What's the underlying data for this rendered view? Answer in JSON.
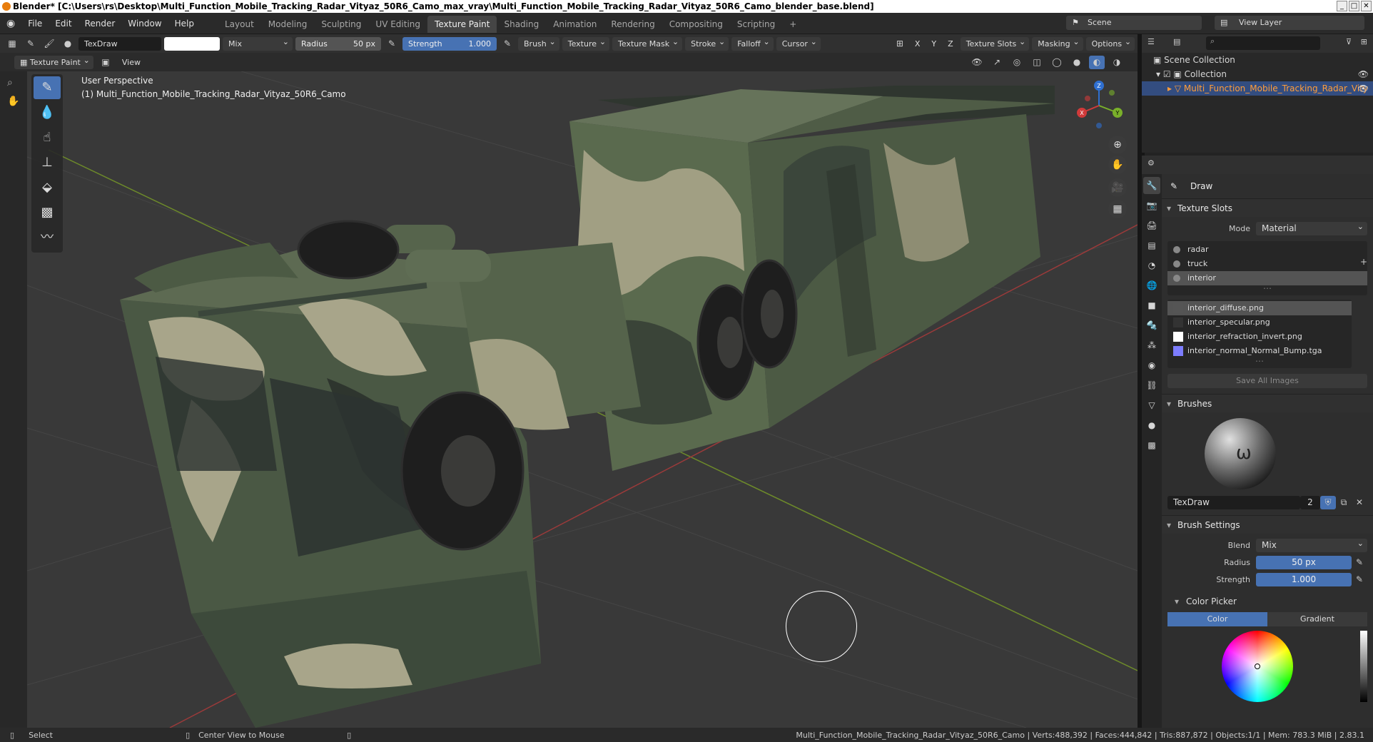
{
  "window": {
    "title": "Blender* [C:\\Users\\rs\\Desktop\\Multi_Function_Mobile_Tracking_Radar_Vityaz_50R6_Camo_max_vray\\Multi_Function_Mobile_Tracking_Radar_Vityaz_50R6_Camo_blender_base.blend]"
  },
  "menu": [
    "File",
    "Edit",
    "Render",
    "Window",
    "Help"
  ],
  "workspaces": [
    {
      "label": "Layout"
    },
    {
      "label": "Modeling"
    },
    {
      "label": "Sculpting"
    },
    {
      "label": "UV Editing"
    },
    {
      "label": "Texture Paint",
      "active": true
    },
    {
      "label": "Shading"
    },
    {
      "label": "Animation"
    },
    {
      "label": "Rendering"
    },
    {
      "label": "Compositing"
    },
    {
      "label": "Scripting"
    }
  ],
  "add_ws": "+",
  "scene": "Scene",
  "view_layer": "View Layer",
  "tool_header": {
    "brush_name": "TexDraw",
    "blend": "Mix",
    "radius_label": "Radius",
    "radius_value": "50 px",
    "strength_label": "Strength",
    "strength_value": "1.000",
    "menus": [
      "Brush",
      "Texture",
      "Texture Mask",
      "Stroke",
      "Falloff",
      "Cursor"
    ],
    "axes": [
      "X",
      "Y",
      "Z"
    ],
    "texture_slots": "Texture Slots",
    "masking": "Masking",
    "options": "Options"
  },
  "header2": {
    "mode": "Texture Paint",
    "view": "View"
  },
  "viewport": {
    "perspective": "User Perspective",
    "object_label": "(1) Multi_Function_Mobile_Tracking_Radar_Vityaz_50R6_Camo"
  },
  "gizmo": {
    "x": "X",
    "y": "Y",
    "z": "Z"
  },
  "outliner": {
    "scene_collection": "Scene Collection",
    "collection": "Collection",
    "object": "Multi_Function_Mobile_Tracking_Radar_Vity"
  },
  "props": {
    "tool_name": "Draw",
    "texture_slots": {
      "header": "Texture Slots",
      "mode_label": "Mode",
      "mode_value": "Material",
      "materials": [
        "radar",
        "truck",
        "interior"
      ],
      "selected_material": 2,
      "images": [
        "interior_diffuse.png",
        "interior_specular.png",
        "interior_refraction_invert.png",
        "interior_normal_Normal_Bump.tga"
      ],
      "selected_image": 0,
      "save_all": "Save All Images"
    },
    "brushes": {
      "header": "Brushes",
      "brush_name": "TexDraw",
      "users": "2"
    },
    "brush_settings": {
      "header": "Brush Settings",
      "blend_label": "Blend",
      "blend_value": "Mix",
      "radius_label": "Radius",
      "radius_value": "50 px",
      "strength_label": "Strength",
      "strength_value": "1.000"
    },
    "color_picker": {
      "header": "Color Picker",
      "tab_color": "Color",
      "tab_gradient": "Gradient"
    }
  },
  "statusbar": {
    "select": "Select",
    "center_view": "Center View to Mouse",
    "stats": "Multi_Function_Mobile_Tracking_Radar_Vityaz_50R6_Camo | Verts:488,392 | Faces:444,842 | Tris:887,872 | Objects:1/1 | Mem: 783.3 MiB | 2.83.1"
  },
  "colors": {
    "accent": "#4772b3",
    "selected_object": "#ff9d3a",
    "camo_dark": "#3f4a3f",
    "camo_green": "#6b7c5c",
    "camo_tan": "#a8a58a"
  }
}
